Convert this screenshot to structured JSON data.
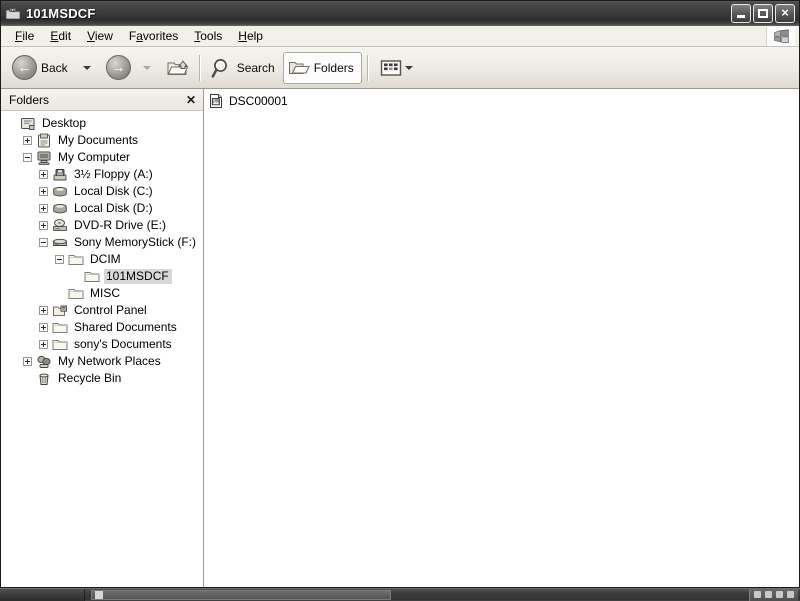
{
  "window": {
    "title": "101MSDCF",
    "title_icon": "camera-folder-icon",
    "caption": {
      "minimize": "minimize-button",
      "maximize": "maximize-button",
      "close_glyph": "×"
    }
  },
  "menubar": {
    "items": [
      {
        "label": "File",
        "accel": "F"
      },
      {
        "label": "Edit",
        "accel": "E"
      },
      {
        "label": "View",
        "accel": "V"
      },
      {
        "label": "Favorites",
        "accel": "a"
      },
      {
        "label": "Tools",
        "accel": "T"
      },
      {
        "label": "Help",
        "accel": "H"
      }
    ],
    "logo": "windows-flag-logo"
  },
  "toolbar": {
    "back_label": "Back",
    "forward_label": "",
    "up_label": "",
    "search_label": "Search",
    "folders_label": "Folders",
    "views_label": "",
    "folders_active": true,
    "forward_disabled": true
  },
  "folders_pane": {
    "header_title": "Folders",
    "close_glyph": "✕",
    "tree": [
      {
        "label": "Desktop",
        "indent": 0,
        "expander": "none",
        "icon": "desktop-icon",
        "selected": false
      },
      {
        "label": "My Documents",
        "indent": 1,
        "expander": "plus",
        "icon": "documents-icon",
        "selected": false
      },
      {
        "label": "My Computer",
        "indent": 1,
        "expander": "minus",
        "icon": "computer-icon",
        "selected": false
      },
      {
        "label": "3½ Floppy (A:)",
        "indent": 2,
        "expander": "plus",
        "icon": "floppy-icon",
        "selected": false
      },
      {
        "label": "Local Disk (C:)",
        "indent": 2,
        "expander": "plus",
        "icon": "harddisk-icon",
        "selected": false
      },
      {
        "label": "Local Disk (D:)",
        "indent": 2,
        "expander": "plus",
        "icon": "harddisk-icon",
        "selected": false
      },
      {
        "label": "DVD-R Drive (E:)",
        "indent": 2,
        "expander": "plus",
        "icon": "dvd-drive-icon",
        "selected": false
      },
      {
        "label": "Sony MemoryStick (F:)",
        "indent": 2,
        "expander": "minus",
        "icon": "removable-disk-icon",
        "selected": false
      },
      {
        "label": "DCIM",
        "indent": 3,
        "expander": "minus",
        "icon": "folder-icon",
        "selected": false
      },
      {
        "label": "101MSDCF",
        "indent": 4,
        "expander": "none",
        "icon": "folder-icon",
        "selected": true
      },
      {
        "label": "MISC",
        "indent": 3,
        "expander": "none",
        "icon": "folder-icon",
        "selected": false
      },
      {
        "label": "Control Panel",
        "indent": 2,
        "expander": "plus",
        "icon": "control-panel-icon",
        "selected": false
      },
      {
        "label": "Shared Documents",
        "indent": 2,
        "expander": "plus",
        "icon": "folder-icon",
        "selected": false
      },
      {
        "label": "sony's Documents",
        "indent": 2,
        "expander": "plus",
        "icon": "folder-icon",
        "selected": false
      },
      {
        "label": "My Network Places",
        "indent": 1,
        "expander": "plus",
        "icon": "network-icon",
        "selected": false
      },
      {
        "label": "Recycle Bin",
        "indent": 1,
        "expander": "none",
        "icon": "recycle-bin-icon",
        "selected": false
      }
    ]
  },
  "content_pane": {
    "files": [
      {
        "name": "DSC00001",
        "icon": "image-file-icon"
      }
    ]
  },
  "taskbar": {
    "start_label": "",
    "task_button_label": "",
    "tray_icons": [
      "tray-icon-1",
      "tray-icon-2",
      "tray-icon-3",
      "tray-icon-4"
    ]
  },
  "colors": {
    "titlebar": "#3c3c3c",
    "toolbar": "#eceae3",
    "selection": "#d8d8d8",
    "pane_bg": "#ffffff"
  }
}
